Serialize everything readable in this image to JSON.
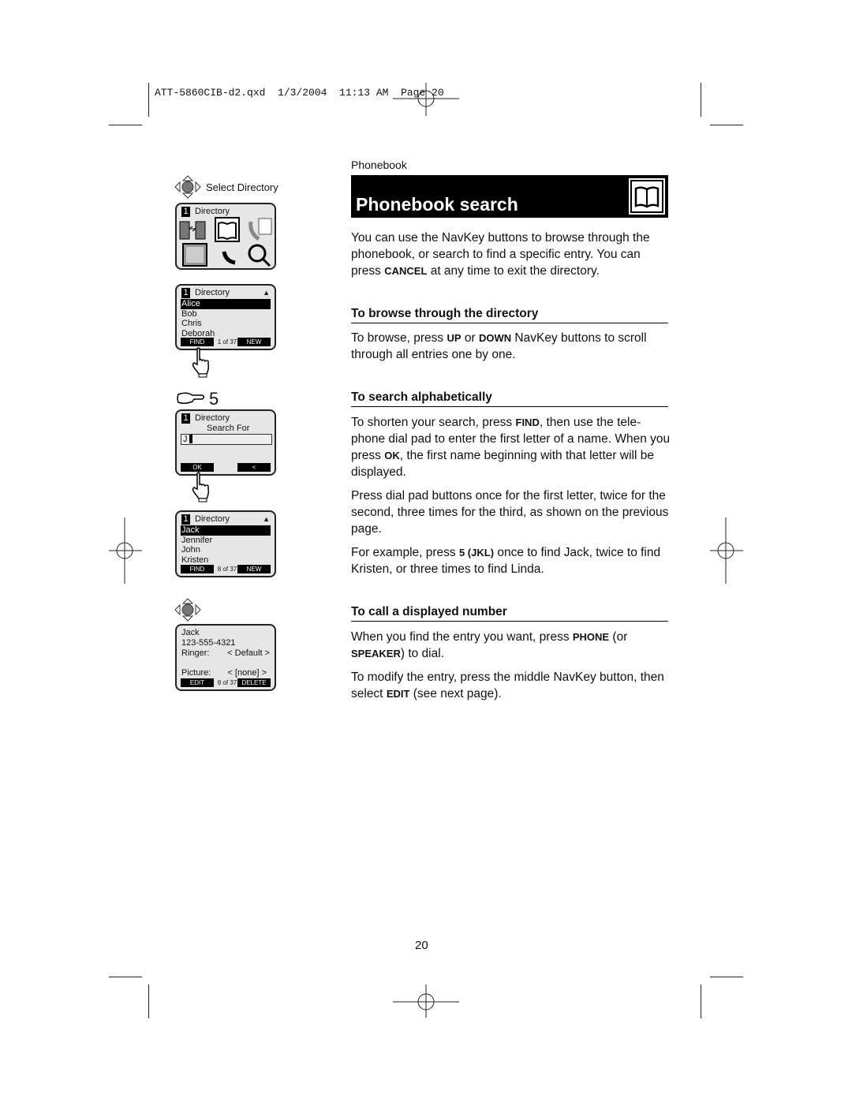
{
  "slug": "ATT-5860CIB-d2.qxd  1/3/2004  11:13 AM  Page 20",
  "section": "Phonebook",
  "title": "Phonebook search",
  "intro": [
    "You can use the NavKey buttons to browse through the phonebook, or search to find a specific entry. You can press ",
    "CANCEL",
    " at any time to exit the directory."
  ],
  "browse": {
    "heading": "To browse through the directory",
    "text": [
      "To browse, press ",
      "UP",
      " or ",
      "DOWN",
      " NavKey buttons to scroll through all entries one by one."
    ]
  },
  "search": {
    "heading": "To search alphabetically",
    "p1": [
      "To shorten your search, press ",
      "FIND",
      ", then use the tele-phone dial pad to enter the first letter of a name. When you press ",
      "OK",
      ", the first name beginning with that letter will be displayed."
    ],
    "p2": "Press dial pad buttons once for the first letter, twice for the second, three times for the third, as shown on the previous page.",
    "p3": [
      "For example, press ",
      "5 (JKL)",
      " once to find Jack, twice to find Kristen, or three times to find Linda."
    ]
  },
  "call": {
    "heading": "To call a displayed number",
    "p1": [
      "When you find the entry you want, press ",
      "PHONE",
      " (or ",
      "SPEAKER",
      ") to dial."
    ],
    "p2": [
      "To modify the entry, press the middle NavKey button, then select ",
      "EDIT",
      " (see next page)."
    ]
  },
  "left": {
    "select_label": "Select Directory",
    "key_label": "5",
    "screen1": {
      "num": "1",
      "title": "Directory"
    },
    "screen2": {
      "num": "1",
      "title": "Directory",
      "items": [
        "Alice",
        "Bob",
        "Chris",
        "Deborah"
      ],
      "left": "FIND",
      "count": "1 of 37",
      "right": "NEW"
    },
    "screen3": {
      "num": "1",
      "title": "Directory",
      "prompt": "Search For",
      "value": "J",
      "left": "OK",
      "right": "<"
    },
    "screen4": {
      "num": "1",
      "title": "Directory",
      "items": [
        "Jack",
        "Jennifer",
        "John",
        "Kristen"
      ],
      "left": "FIND",
      "count": "8 of 37",
      "right": "NEW"
    },
    "screen5": {
      "name": "Jack",
      "number": "123-555-4321",
      "ringer_label": "Ringer:",
      "ringer_value": "< Default >",
      "picture_label": "Picture:",
      "picture_value": "< [none] >",
      "left": "EDIT",
      "count": "8 of 37",
      "right": "DELETE"
    }
  },
  "page_number": "20"
}
